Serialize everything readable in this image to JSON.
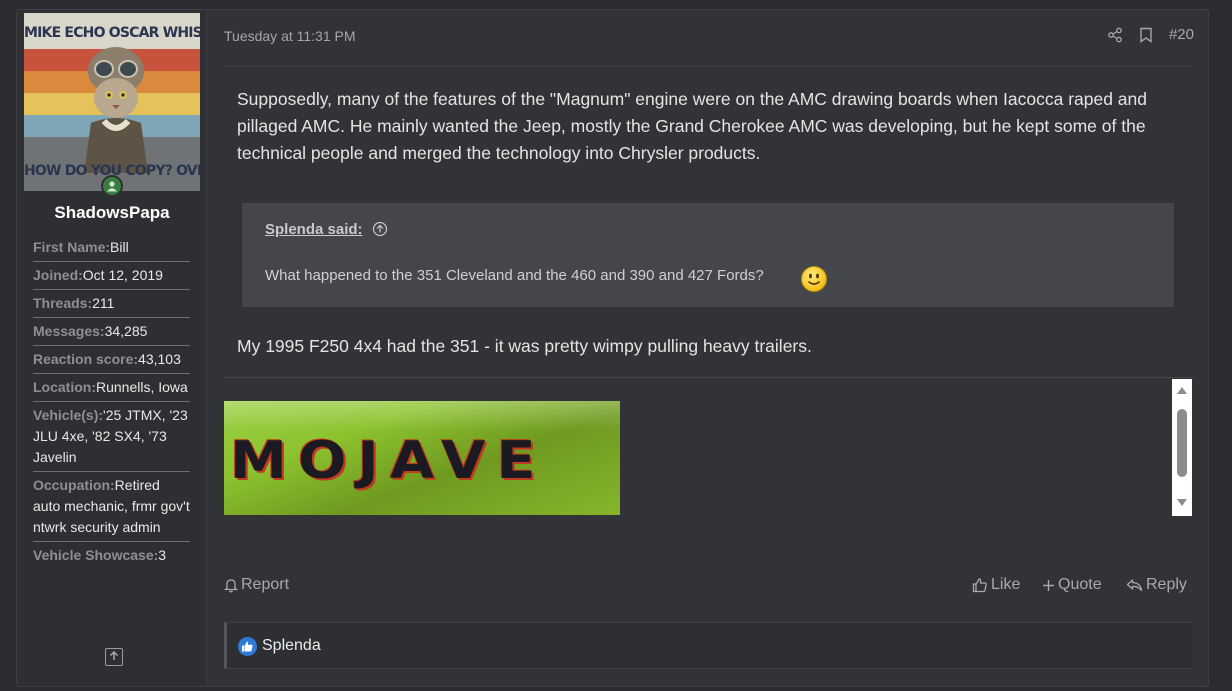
{
  "author": {
    "avatar_top_text": "MIKE ECHO OSCAR WHISKY",
    "avatar_bottom_text": "HOW DO YOU COPY? OVER",
    "username": "ShadowsPapa",
    "fields": [
      {
        "key": "First Name:",
        "value": "Bill"
      },
      {
        "key": "Joined:",
        "value": "Oct 12, 2019"
      },
      {
        "key": "Threads:",
        "value": "211"
      },
      {
        "key": "Messages:",
        "value": "34,285"
      },
      {
        "key": "Reaction score:",
        "value": "43,103"
      },
      {
        "key": "Location:",
        "value": "Runnells, Iowa"
      },
      {
        "key": "Vehicle(s):",
        "value": "'25 JTMX, '23 JLU 4xe, '82 SX4, '73 Javelin"
      },
      {
        "key": "Occupation:",
        "value": "Retired auto mechanic, frmr gov't ntwrk security admin"
      },
      {
        "key": "Vehicle Showcase:",
        "value": "3"
      }
    ]
  },
  "post": {
    "timestamp": "Tuesday at 11:31 PM",
    "number": "#20",
    "body": "Supposedly, many of the features of the \"Magnum\" engine were on the AMC drawing boards when Iacocca raped and pillaged AMC. He mainly wanted the Jeep, mostly the Grand Cherokee AMC was developing, but he kept some of the technical people and merged the technology into Chrysler products.",
    "quote": {
      "author": "Splenda said:",
      "text": "What happened to the 351 Cleveland and the 460 and 390 and 427 Fords?"
    },
    "reply": "My 1995 F250 4x4 had the 351 - it was pretty wimpy pulling heavy trailers.",
    "attachment_text": "MOJAVE"
  },
  "actions": {
    "report": "Report",
    "like": "Like",
    "quote": "Quote",
    "reply": "Reply"
  },
  "reactions": {
    "users": "Splenda"
  },
  "colors": {
    "page_bg": "#2b2c30",
    "post_bg": "#323337",
    "quote_bg": "#45464b",
    "like_blue": "#2e7bd6",
    "online_green": "#3b7d3f"
  }
}
